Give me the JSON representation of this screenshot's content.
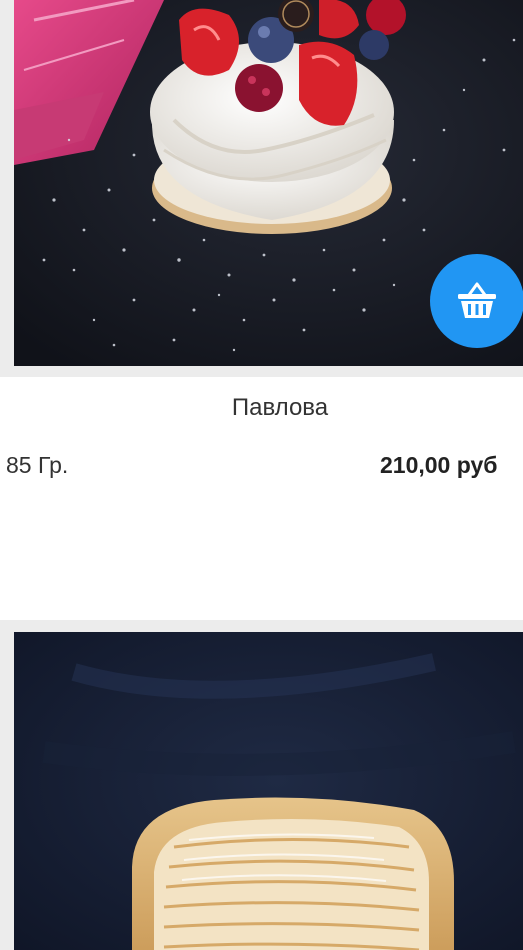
{
  "products": [
    {
      "name": "Павлова",
      "weight": "85 Гр.",
      "price": "210,00 руб",
      "image_icon": "pavlova-dessert-photo",
      "cart_icon": "basket-icon"
    },
    {
      "image_icon": "apple-tart-photo"
    }
  ],
  "colors": {
    "accent": "#2196f3",
    "text": "#333333",
    "card_frame": "#ececec"
  }
}
